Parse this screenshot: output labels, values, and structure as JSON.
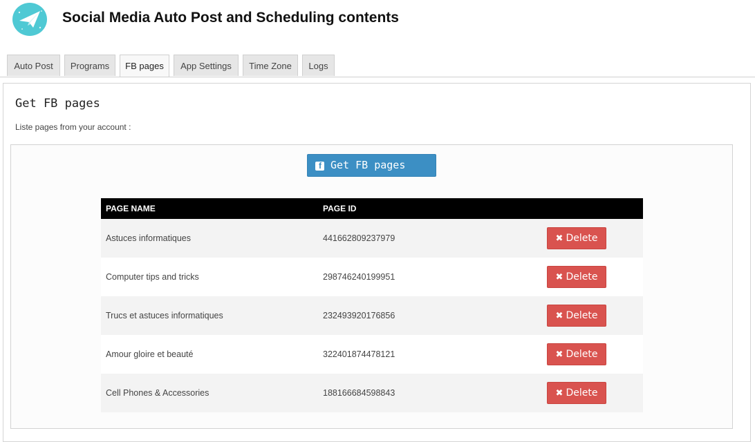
{
  "header": {
    "title": "Social Media Auto Post and Scheduling contents",
    "logo_icon": "paper-plane-icon",
    "logo_color": "#4fc9d4"
  },
  "tabs": [
    {
      "label": "Auto Post",
      "active": false
    },
    {
      "label": "Programs",
      "active": false
    },
    {
      "label": "FB pages",
      "active": true
    },
    {
      "label": "App Settings",
      "active": false
    },
    {
      "label": "Time Zone",
      "active": false
    },
    {
      "label": "Logs",
      "active": false
    }
  ],
  "section": {
    "title": "Get FB pages",
    "subtitle": "Liste pages from your account :",
    "get_button_label": "Get FB pages",
    "get_button_icon": "facebook-icon",
    "get_button_color": "#3c8fc4"
  },
  "table": {
    "headers": {
      "name": "PAGE NAME",
      "id": "PAGE ID"
    },
    "delete_label": "Delete",
    "delete_icon": "times-icon",
    "delete_color": "#d9534f",
    "rows": [
      {
        "name": "Astuces informatiques",
        "id": "441662809237979"
      },
      {
        "name": "Computer tips and tricks",
        "id": "298746240199951"
      },
      {
        "name": "Trucs et astuces informatiques",
        "id": "232493920176856"
      },
      {
        "name": "Amour gloire et beauté",
        "id": "322401874478121"
      },
      {
        "name": "Cell Phones & Accessories",
        "id": "188166684598843"
      }
    ]
  }
}
